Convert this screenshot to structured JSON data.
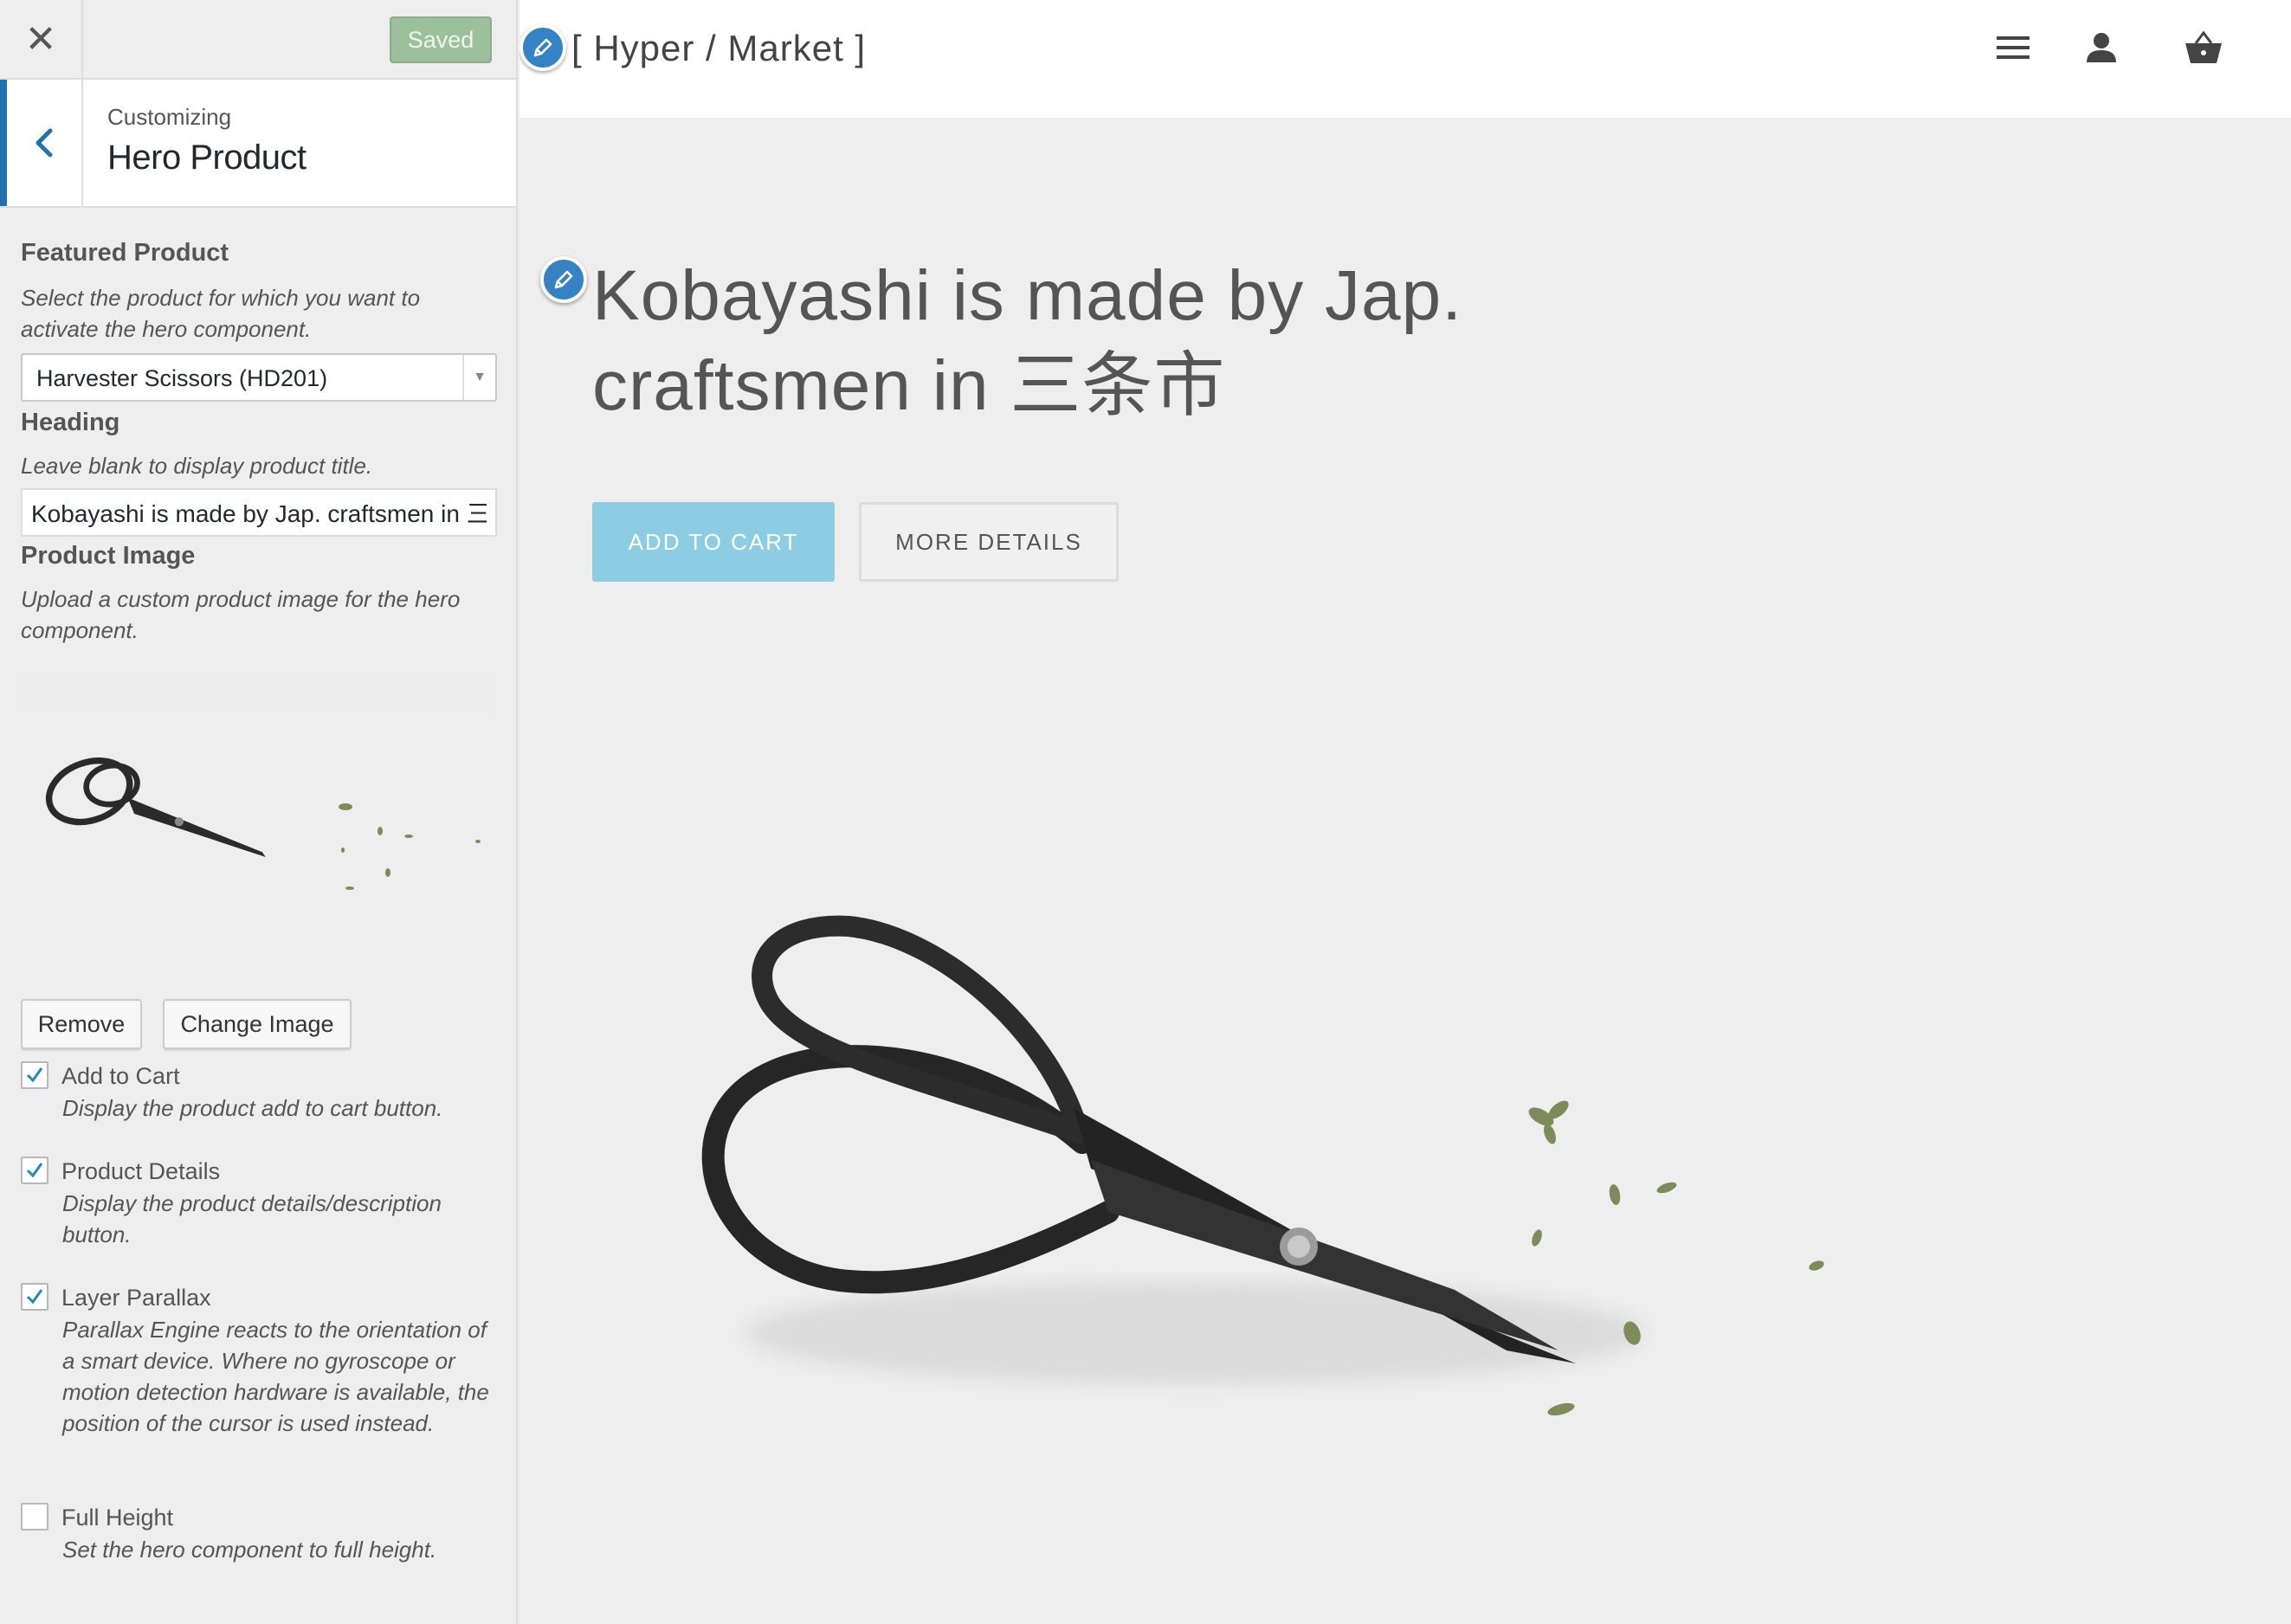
{
  "customizer": {
    "close_glyph": "✕",
    "saved_label": "Saved",
    "breadcrumb": "Customizing",
    "section_title": "Hero Product",
    "featured_product": {
      "title": "Featured Product",
      "description": "Select the product for which you want to activate the hero component.",
      "selected": "Harvester Scissors (HD201)"
    },
    "heading": {
      "title": "Heading",
      "description": "Leave blank to display product title.",
      "value": "Kobayashi is made by Jap. craftsmen in 三条市"
    },
    "product_image": {
      "title": "Product Image",
      "description": "Upload a custom product image for the hero component.",
      "remove_label": "Remove",
      "change_label": "Change Image"
    },
    "options": [
      {
        "label": "Add to Cart",
        "description": "Display the product add to cart button.",
        "checked": true
      },
      {
        "label": "Product Details",
        "description": "Display the product details/description button.",
        "checked": true
      },
      {
        "label": "Layer Parallax",
        "description": "Parallax Engine reacts to the orientation of a smart device. Where no gyroscope or motion detection hardware is available, the position of the cursor is used instead.",
        "checked": true
      },
      {
        "label": "Full Height",
        "description": "Set the hero component to full height.",
        "checked": false
      }
    ]
  },
  "preview": {
    "brand": "[ Hyper / Market ]",
    "header_icons": [
      "menu-icon",
      "user-icon",
      "cart-icon"
    ],
    "hero_heading_line1": "Kobayashi is made by Jap.",
    "hero_heading_line2": "craftsmen in 三条市",
    "add_to_cart_label": "ADD TO CART",
    "more_details_label": "MORE DETAILS"
  },
  "colors": {
    "accent_blue": "#2271b1",
    "add_to_cart_bg": "#8ccde3",
    "saved_bg": "#9cbf9c"
  }
}
